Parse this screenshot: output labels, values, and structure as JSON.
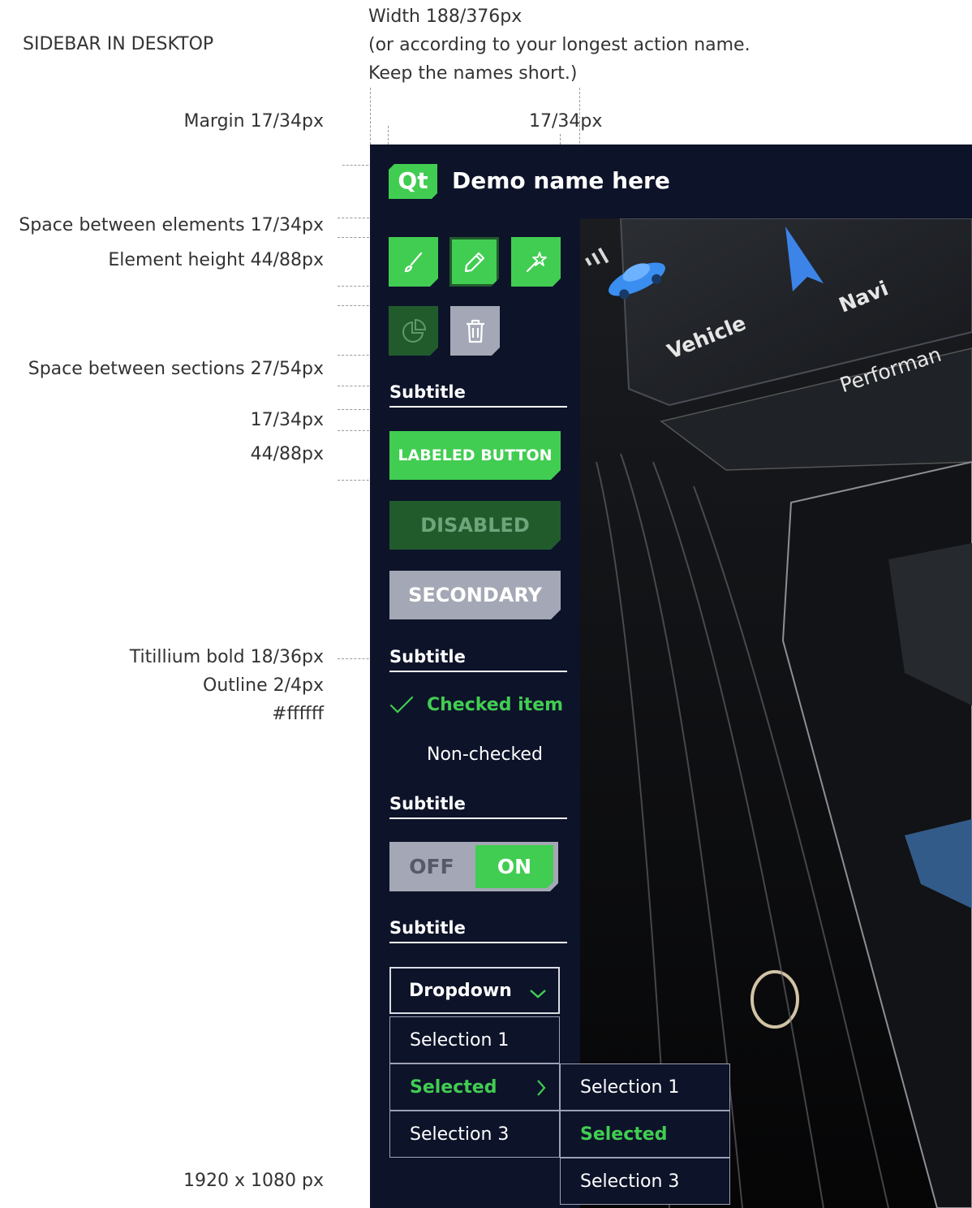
{
  "annotations": {
    "sidebar_label": "SIDEBAR IN DESKTOP",
    "width_line1": "Width 188/376px",
    "width_line2": "(or according to your longest action name.",
    "width_line3": "Keep the names short.)",
    "margin": "Margin 17/34px",
    "right_margin": "17/34px",
    "space_elements": "Space between elements 17/34px",
    "element_height": "Element height 44/88px",
    "space_sections": "Space between sections 27/54px",
    "subtitle_gap": "17/34px",
    "button_height": "44/88px",
    "font_spec": "Titillium bold 18/36px",
    "outline_spec": "Outline 2/4px",
    "color_spec": "#ffffff",
    "screen_size": "1920 x 1080 px"
  },
  "app": {
    "logo": "Qt",
    "title": "Demo name here"
  },
  "sidebar": {
    "icon_buttons": [
      {
        "icon": "brush-icon"
      },
      {
        "icon": "pencil-icon"
      },
      {
        "icon": "magic-wand-icon"
      },
      {
        "icon": "pie-chart-icon"
      },
      {
        "icon": "trash-icon"
      }
    ],
    "sections": {
      "buttons_subtitle": "Subtitle",
      "checks_subtitle": "Subtitle",
      "toggle_subtitle": "Subtitle",
      "dropdown_subtitle": "Subtitle"
    },
    "buttons": {
      "primary": "LABELED BUTTON",
      "disabled": "DISABLED",
      "secondary": "SECONDARY"
    },
    "checklist": {
      "checked": "Checked item",
      "unchecked": "Non-checked"
    },
    "toggle": {
      "off": "OFF",
      "on": "ON"
    },
    "dropdown": {
      "label": "Dropdown",
      "items": [
        "Selection 1",
        "Selected",
        "Selection 3"
      ],
      "submenu": [
        "Selection 1",
        "Selected",
        "Selection 3"
      ]
    }
  },
  "background_labels": {
    "vehicle": "Vehicle",
    "navi": "Navi",
    "performance": "Performan"
  },
  "colors": {
    "accent": "#41cd52",
    "accent_dark": "#215b2c",
    "secondary": "#a4a7b5",
    "background": "#0d1329",
    "text": "#ffffff"
  }
}
